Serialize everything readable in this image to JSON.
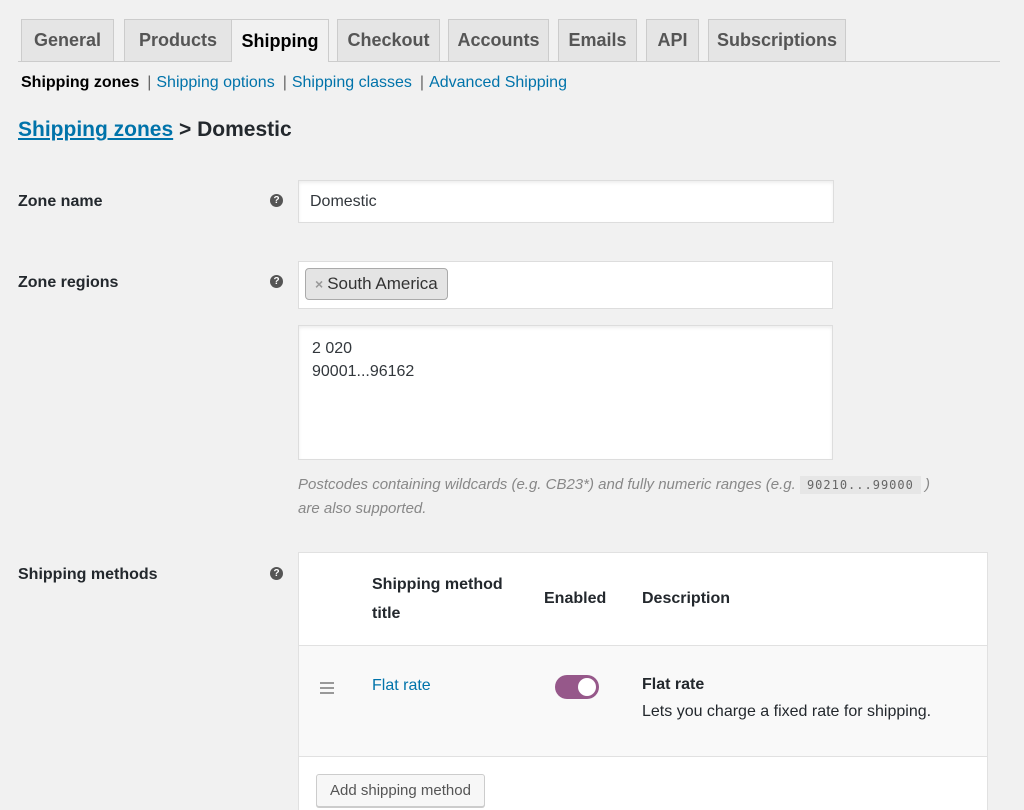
{
  "tabs": [
    {
      "label": "General",
      "active": false
    },
    {
      "label": "Products",
      "active": false
    },
    {
      "label": "Shipping",
      "active": true
    },
    {
      "label": "Checkout",
      "active": false
    },
    {
      "label": "Accounts",
      "active": false
    },
    {
      "label": "Emails",
      "active": false
    },
    {
      "label": "API",
      "active": false
    },
    {
      "label": "Subscriptions",
      "active": false
    }
  ],
  "subnav": {
    "current": "Shipping zones",
    "links": [
      "Shipping options",
      "Shipping classes",
      "Advanced Shipping"
    ],
    "separator": "|"
  },
  "breadcrumb": {
    "parent": "Shipping zones",
    "separator": ">",
    "current": "Domestic"
  },
  "zone_name": {
    "label": "Zone name",
    "value": "Domestic"
  },
  "zone_regions": {
    "label": "Zone regions",
    "chips": [
      "South America"
    ],
    "chip_remove": "×",
    "postcodes": "2 020\n90001...96162",
    "hint_before": "Postcodes containing wildcards (e.g. CB23*) and fully numeric ranges (e.g.",
    "hint_code": "90210...99000",
    "hint_after": ")",
    "hint_line2": "are also supported."
  },
  "shipping_methods": {
    "label": "Shipping methods",
    "columns": {
      "title_line1": "Shipping method",
      "title_line2": "title",
      "enabled": "Enabled",
      "description": "Description"
    },
    "rows": [
      {
        "title": "Flat rate",
        "enabled": true,
        "desc_title": "Flat rate",
        "desc_text": "Lets you charge a fixed rate for shipping."
      }
    ],
    "add_button": "Add shipping method"
  },
  "help_glyph": "?",
  "colors": {
    "link": "#0073aa",
    "toggle_on": "#96588a",
    "background": "#f1f1f1"
  }
}
